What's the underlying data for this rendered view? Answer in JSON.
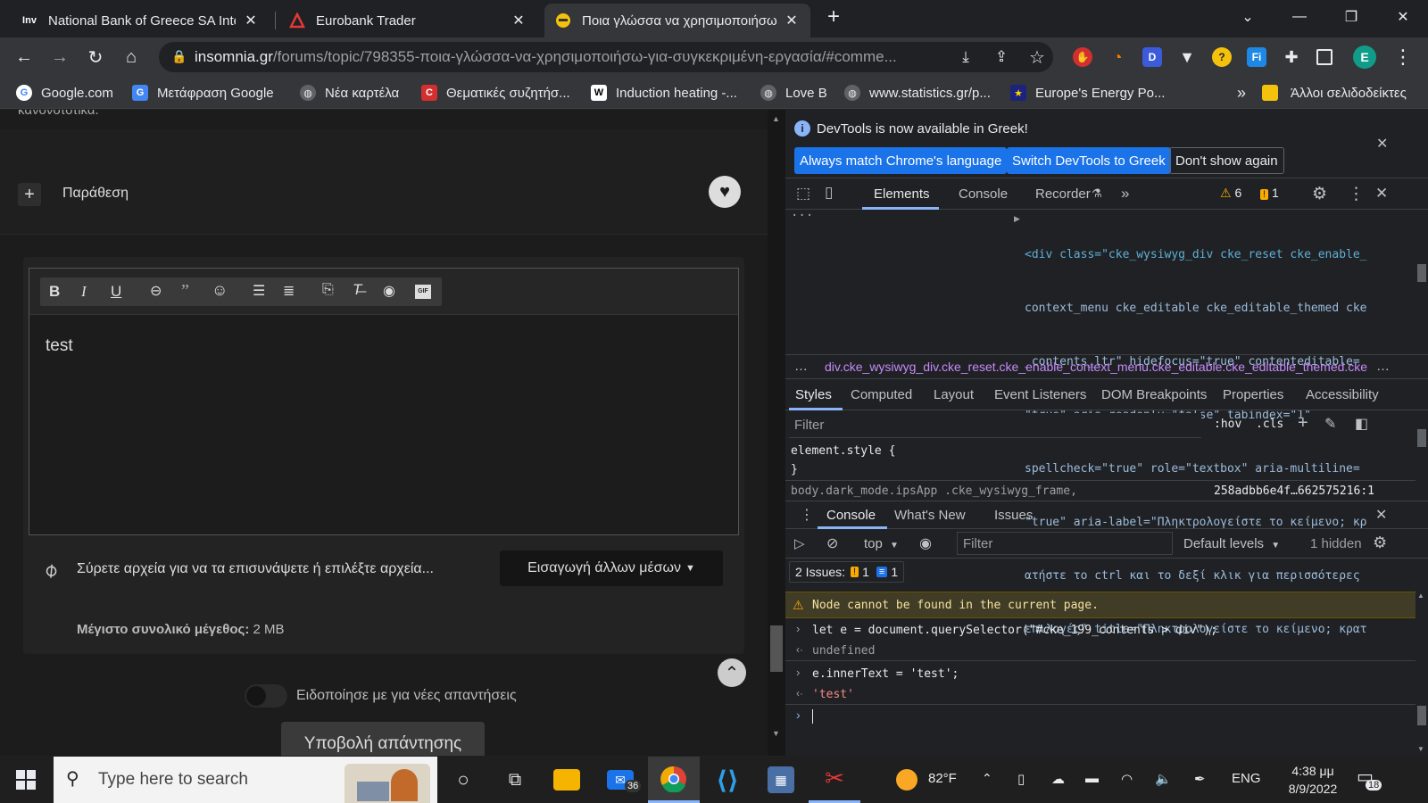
{
  "tabs": [
    {
      "title": "National Bank of Greece SA Inter",
      "favicon": "Inv"
    },
    {
      "title": "Eurobank Trader",
      "favicon": "eurobank-icon"
    },
    {
      "title": "Ποια γλώσσα να χρησιμοποιήσω",
      "favicon": "insomnia-icon"
    }
  ],
  "address": {
    "host": "insomnia.gr",
    "path": "/forums/topic/798355-ποια-γλώσσα-να-χρησιμοποιήσω-για-συγκεκριμένη-εργασία/#comme..."
  },
  "bookmarks": [
    {
      "label": "Google.com"
    },
    {
      "label": "Μετάφραση Google"
    },
    {
      "label": "Νέα καρτέλα"
    },
    {
      "label": "Θεματικές συζητήσ..."
    },
    {
      "label": "Induction heating -..."
    },
    {
      "label": "Love B"
    },
    {
      "label": "www.statistics.gr/p..."
    },
    {
      "label": "Europe's Energy Po..."
    }
  ],
  "bookmarks_more": "»",
  "bookmarks_other": "Άλλοι σελιδοδείκτες",
  "profile_initial": "E",
  "page": {
    "top_partial_text": "κανονοτοτικα.",
    "quote_label": "Παράθεση",
    "editor_text": "test",
    "attach_text": "Σύρετε αρχεία για να τα επισυνάψετε ή επιλέξτε αρχεία...",
    "insert_media": "Εισαγωγή άλλων μέσων",
    "max_size_label": "Μέγιστο συνολικό μέγεθος:",
    "max_size_value": "2 MB",
    "notify_label": "Ειδοποίησε με για νέες απαντήσεις",
    "submit_label": "Υποβολή απάντησης"
  },
  "devtools": {
    "banner": "DevTools is now available in Greek!",
    "btn_match": "Always match Chrome's language",
    "btn_switch": "Switch DevTools to Greek",
    "btn_dont": "Don't show again",
    "tabs": [
      "Elements",
      "Console",
      "Recorder"
    ],
    "warn_count": "6",
    "issue_count": "1",
    "html_lines": [
      "<div class=\"cke_wysiwyg_div cke_reset cke_enable_",
      "context_menu cke_editable cke_editable_themed cke",
      "_contents_ltr\" hidefocus=\"true\" contenteditable=",
      "\"true\" aria-readonly=\"false\" tabindex=\"1\"",
      "spellcheck=\"true\" role=\"textbox\" aria-multiline=",
      "\"true\" aria-label=\"Πληκτρολογείστε το κείμενο; κρ",
      "ατήστε το ctrl και το δεξί κλικ για περισσότερες",
      "επιλογές\" title=\"Πληκτρολογείστε το κείμενο; κρατ"
    ],
    "breadcrumb": "div.cke_wysiwyg_div.cke_reset.cke_enable_context_menu.cke_editable.cke_editable_themed.cke",
    "style_tabs": [
      "Styles",
      "Computed",
      "Layout",
      "Event Listeners",
      "DOM Breakpoints",
      "Properties",
      "Accessibility"
    ],
    "filter_placeholder": "Filter",
    "hov": ":hov",
    "cls": ".cls",
    "element_style_open": "element.style {",
    "element_style_close": "}",
    "rule_selector": "body.dark_mode.ipsApp .cke_wysiwyg_frame,",
    "rule_source": "258adbb6e4f…662575216:1",
    "drawer_tabs": [
      "Console",
      "What's New",
      "Issues"
    ],
    "context": "top",
    "levels": "Default levels",
    "hidden": "1 hidden",
    "issues_label": "2 Issues:",
    "issues_warn": "1",
    "issues_info": "1",
    "console": {
      "warning": "Node cannot be found in the current page.",
      "in1": "let e = document.querySelector(\"#cke_199_contents > div\");",
      "out1": "undefined",
      "in2": "e.innerText = 'test';",
      "out2": "'test'"
    }
  },
  "taskbar": {
    "search_placeholder": "Type here to search",
    "mail_badge": "36",
    "weather": "82°F",
    "lang": "ENG",
    "time": "4:38 μμ",
    "date": "8/9/2022",
    "notif": "18"
  },
  "colors": {
    "devtools_blue": "#1a73e8",
    "warning_bg": "#413c26",
    "accent_blue": "#8ab4f8"
  }
}
